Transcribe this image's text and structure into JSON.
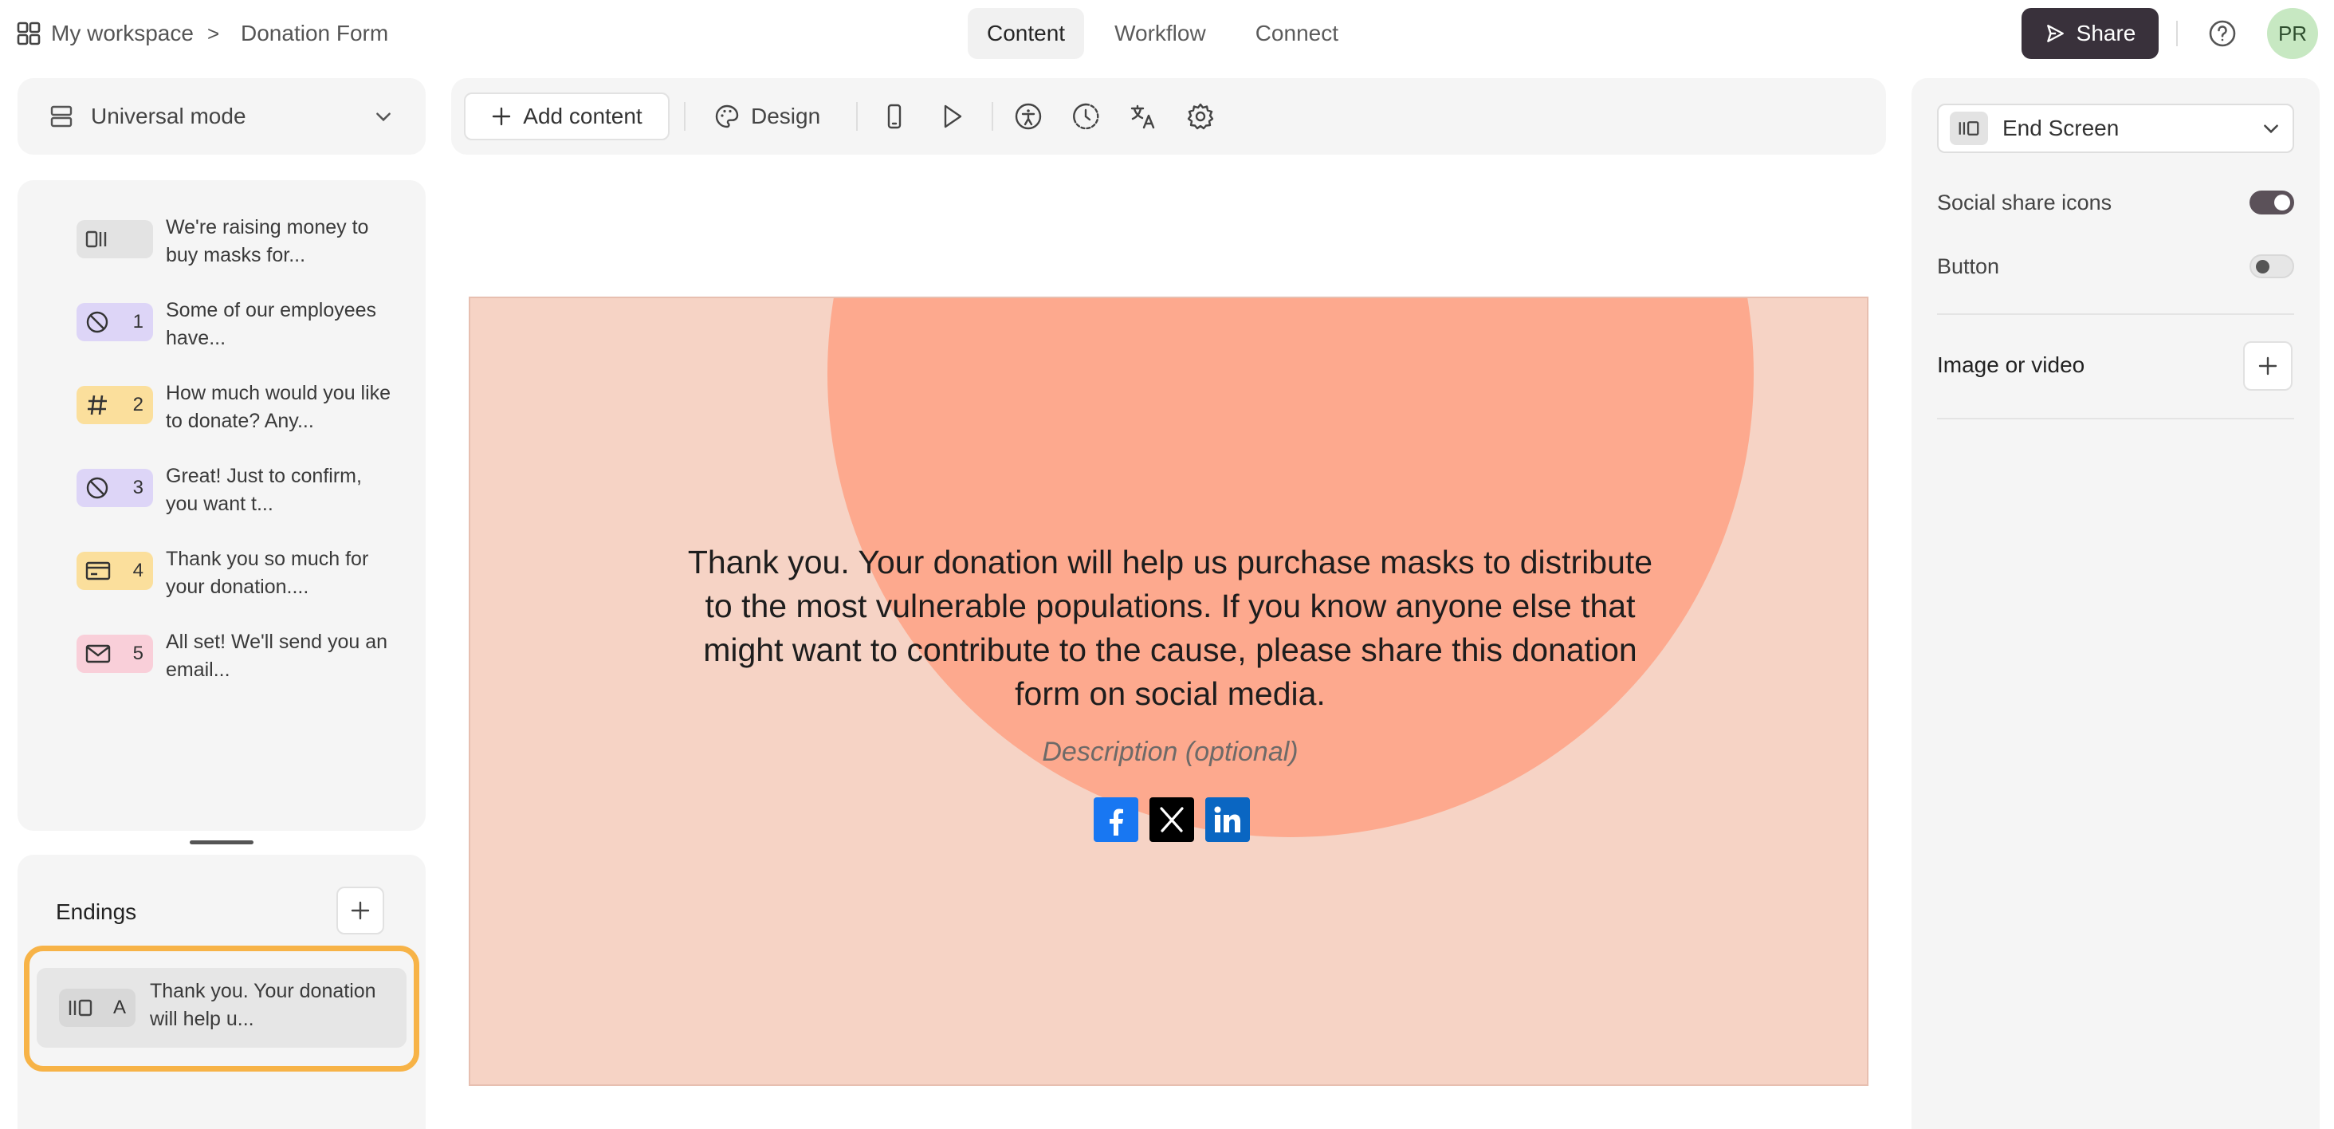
{
  "breadcrumb": {
    "workspace": "My workspace",
    "separator": ">",
    "form_name": "Donation Form"
  },
  "nav_tabs": [
    {
      "label": "Content",
      "active": true
    },
    {
      "label": "Workflow",
      "active": false
    },
    {
      "label": "Connect",
      "active": false
    }
  ],
  "header": {
    "share_label": "Share",
    "avatar_initials": "PR"
  },
  "mode": {
    "label": "Universal mode"
  },
  "questions": [
    {
      "number": "",
      "icon": "statement-icon",
      "badge_color": "#e3e3e3",
      "text": "We're raising money to buy masks for..."
    },
    {
      "number": "1",
      "icon": "legal-icon",
      "badge_color": "#ddd5f7",
      "text": "Some of our employees have..."
    },
    {
      "number": "2",
      "icon": "number-icon",
      "badge_color": "#fbdf9c",
      "text": "How much would you like to donate? Any..."
    },
    {
      "number": "3",
      "icon": "legal-icon",
      "badge_color": "#ddd5f7",
      "text": "Great! Just to confirm, you want t..."
    },
    {
      "number": "4",
      "icon": "payment-icon",
      "badge_color": "#fbdf9c",
      "text": "Thank you so much for your donation...."
    },
    {
      "number": "5",
      "icon": "email-icon",
      "badge_color": "#f9cfd9",
      "text": "All set! We'll send you an email..."
    }
  ],
  "endings": {
    "title": "Endings",
    "items": [
      {
        "letter": "A",
        "icon": "end-screen-icon",
        "text": "Thank you. Your donation will help u..."
      }
    ]
  },
  "toolbar": {
    "add_content_label": "Add content",
    "design_label": "Design"
  },
  "end_screen": {
    "title": "Thank you. Your donation will help us purchase masks to distribute to the most vulnerable populations. If you know anyone else that might want to contribute to the cause, please share this donation form on social media.",
    "description_placeholder": "Description (optional)",
    "socials": [
      "facebook",
      "x",
      "linkedin"
    ],
    "background_color": "#f6d3c5",
    "circle_color": "#fda98e"
  },
  "settings": {
    "screen_type": "End Screen",
    "social_share_label": "Social share icons",
    "social_share_on": true,
    "button_label": "Button",
    "button_on": false,
    "image_video_label": "Image or video"
  },
  "colors": {
    "accent_outline": "#f7b347",
    "share_button": "#39313b",
    "avatar_bg": "#c7e8c2"
  }
}
